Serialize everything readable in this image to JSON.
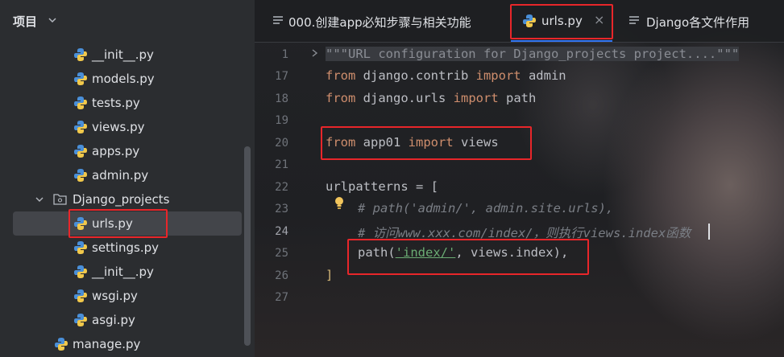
{
  "project_panel": {
    "title": "项目",
    "items": [
      {
        "label": "__init__.py",
        "icon": "python-file-icon"
      },
      {
        "label": "models.py",
        "icon": "python-file-icon"
      },
      {
        "label": "tests.py",
        "icon": "python-file-icon"
      },
      {
        "label": "views.py",
        "icon": "python-file-icon"
      },
      {
        "label": "apps.py",
        "icon": "python-file-icon"
      },
      {
        "label": "admin.py",
        "icon": "python-file-icon"
      },
      {
        "label": "Django_projects",
        "icon": "folder-icon"
      },
      {
        "label": "urls.py",
        "icon": "python-file-icon",
        "selected": true
      },
      {
        "label": "settings.py",
        "icon": "python-file-icon"
      },
      {
        "label": "__init__.py",
        "icon": "python-file-icon"
      },
      {
        "label": "wsgi.py",
        "icon": "python-file-icon"
      },
      {
        "label": "asgi.py",
        "icon": "python-file-icon"
      },
      {
        "label": "manage.py",
        "icon": "python-file-icon"
      }
    ]
  },
  "tabs": [
    {
      "label": "000.创建app必知步骤与相关功能",
      "icon": "text-file-icon"
    },
    {
      "label": "urls.py",
      "icon": "python-file-icon",
      "active": true,
      "close": "×"
    },
    {
      "label": "Django各文件作用",
      "icon": "text-file-icon"
    }
  ],
  "editor": {
    "lines": [
      {
        "num": "1",
        "text": "\"\"\"URL configuration for Django_projects project....\"\"\""
      },
      {
        "num": "17",
        "kw1": "from",
        "mid": " django.contrib ",
        "kw2": "import",
        "end": " admin"
      },
      {
        "num": "18",
        "kw1": "from",
        "mid": " django.urls ",
        "kw2": "import",
        "end": " path"
      },
      {
        "num": "19"
      },
      {
        "num": "20",
        "kw1": "from",
        "mid": " app01 ",
        "kw2": "import",
        "end": " views"
      },
      {
        "num": "21"
      },
      {
        "num": "22",
        "text": "urlpatterns = ["
      },
      {
        "num": "23",
        "text": "# path('admin/', admin.site.urls),"
      },
      {
        "num": "24",
        "text": "# 访问www.xxx.com/index/，则执行views.index函数"
      },
      {
        "num": "25",
        "text_a": "path(",
        "str": "'index/'",
        "text_b": ", views.index),"
      },
      {
        "num": "26",
        "text": "]"
      },
      {
        "num": "27"
      }
    ]
  },
  "colors": {
    "highlight_box": "#e8262a",
    "accent": "#3574f0"
  }
}
